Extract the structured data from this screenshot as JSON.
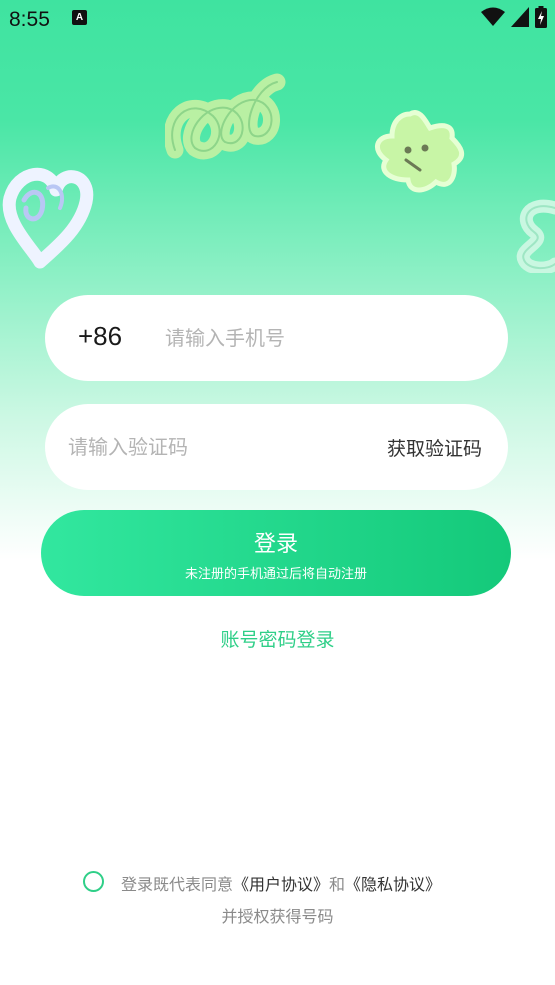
{
  "status_bar": {
    "time": "8:55",
    "notification_glyph": "A",
    "icons": [
      "wifi-icon",
      "cell-signal-icon",
      "battery-charging-icon"
    ]
  },
  "decorations": [
    "squiggle-doodle",
    "star-face-doodle",
    "heart-doodle",
    "swirl-doodle"
  ],
  "phone_field": {
    "country_code": "+86",
    "placeholder": "请输入手机号",
    "value": ""
  },
  "code_field": {
    "placeholder": "请输入验证码",
    "value": "",
    "get_code_label": "获取验证码"
  },
  "login_button": {
    "label": "登录",
    "sublabel": "未注册的手机通过后将自动注册"
  },
  "password_login_label": "账号密码登录",
  "agreement": {
    "checked": false,
    "prefix": "登录既代表同意",
    "user_agreement": "《用户协议》",
    "and": "和",
    "privacy_agreement": "《隐私协议》",
    "line2": "并授权获得号码"
  },
  "colors": {
    "accent": "#2fcf88",
    "button_start": "#32e79f",
    "button_end": "#14c97a",
    "background_top": "#3fe3a0"
  }
}
